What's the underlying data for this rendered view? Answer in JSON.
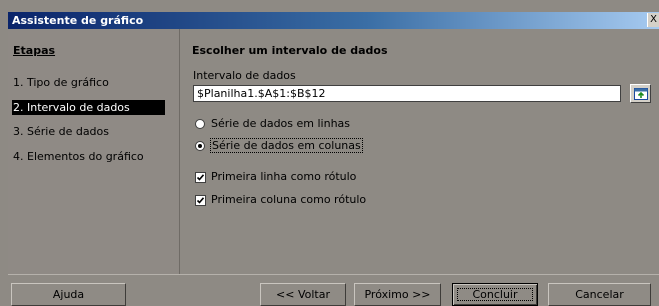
{
  "window": {
    "title": "Assistente de gráfico",
    "close_label": "X"
  },
  "sidebar": {
    "title": "Etapas",
    "steps": [
      {
        "label": "1. Tipo de gráfico"
      },
      {
        "label": "2. Intervalo de dados"
      },
      {
        "label": "3. Série de dados"
      },
      {
        "label": "4. Elementos do gráfico"
      }
    ],
    "active_step": 2
  },
  "main": {
    "heading": "Escolher um intervalo de dados",
    "range_label": "Intervalo de dados",
    "range_value": "$Planilha1.$A$1:$B$12",
    "range_button_icon": "select-range-icon",
    "series_options": [
      {
        "label": "Série de dados em linhas",
        "checked": false
      },
      {
        "label": "Série de dados em colunas",
        "checked": true
      }
    ],
    "checkboxes": [
      {
        "label": "Primeira linha como rótulo",
        "checked": true
      },
      {
        "label": "Primeira coluna como rótulo",
        "checked": true
      }
    ]
  },
  "footer": {
    "help": "Ajuda",
    "back": "<< Voltar",
    "next": "Próximo >>",
    "finish": "Concluir",
    "cancel": "Cancelar"
  }
}
